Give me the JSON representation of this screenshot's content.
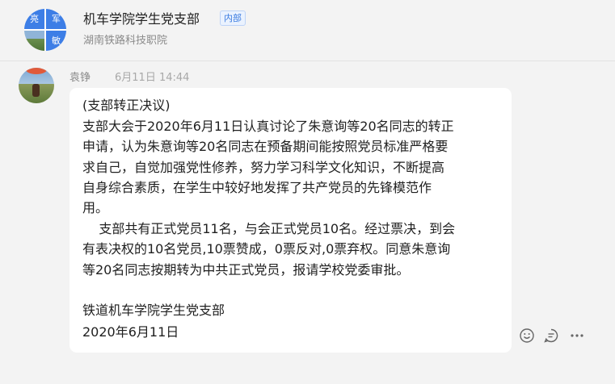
{
  "header": {
    "avatar_chars": [
      "亮",
      "军",
      "敏"
    ],
    "group_name": "机车学院学生党支部",
    "badge": "内部",
    "subtitle": "湖南铁路科技职院"
  },
  "message": {
    "sender": "袁铮",
    "time": "6月11日 14:44",
    "lines": [
      "(支部转正决议)",
      "支部大会于2020年6月11日认真讨论了朱意询等20名同志的转正",
      "申请，认为朱意询等20名同志在预备期间能按照党员标准严格要",
      "求自己，自觉加强党性修养，努力学习科学文化知识，不断提高",
      "自身综合素质，在学生中较好地发挥了共产党员的先锋模范作",
      "用。",
      "    支部共有正式党员11名，与会正式党员10名。经过票决，到会",
      "有表决权的10名党员,10票赞成，0票反对,0票弃权。同意朱意询",
      "等20名同志按期转为中共正式党员，报请学校党委审批。",
      "铁道机车学院学生党支部",
      "2020年6月11日"
    ]
  },
  "actions": {
    "icons": [
      "emoji-icon",
      "reply-icon",
      "more-icon"
    ],
    "icon_color": "#666666"
  },
  "colors": {
    "accent": "#3d7ee6",
    "background": "#f3f3f3",
    "bubble": "#ffffff"
  }
}
